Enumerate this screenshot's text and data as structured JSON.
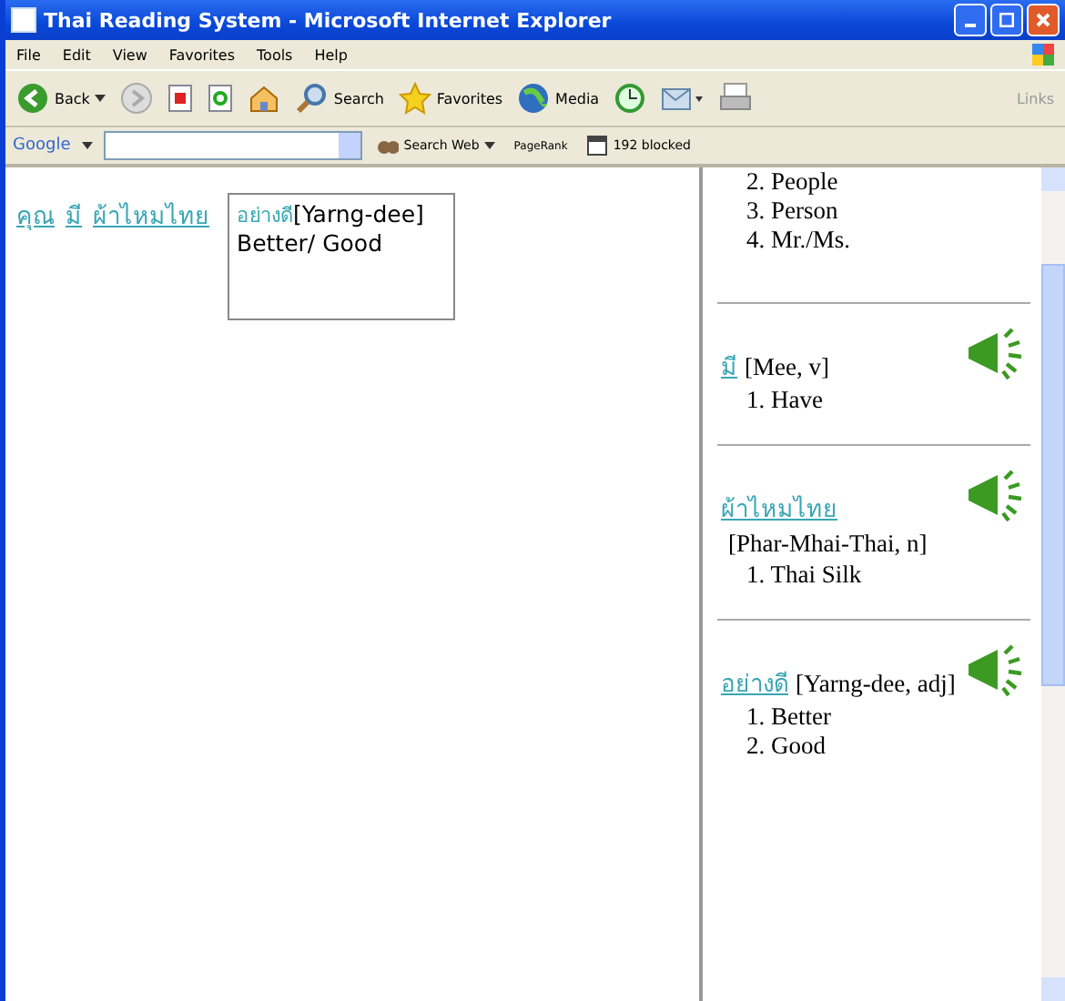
{
  "window": {
    "title": "Thai Reading System - Microsoft Internet Explorer"
  },
  "menu": [
    "File",
    "Edit",
    "View",
    "Favorites",
    "Tools",
    "Help"
  ],
  "toolbar": [
    {
      "kind": "back",
      "label": "Back"
    },
    {
      "kind": "forward"
    },
    {
      "kind": "stop"
    },
    {
      "kind": "refresh"
    },
    {
      "kind": "home"
    },
    {
      "kind": "search",
      "label": "Search"
    },
    {
      "kind": "favorites",
      "label": "Favorites"
    },
    {
      "kind": "media",
      "label": "Media"
    },
    {
      "kind": "history"
    },
    {
      "kind": "mail"
    },
    {
      "kind": "print"
    },
    {
      "kind": "links",
      "label": "Links"
    }
  ],
  "google_bar": {
    "logo": "Google",
    "search_button": "Search Web",
    "pagerank": "PageRank",
    "blocked": "192 blocked"
  },
  "sentence": [
    "คุณ",
    "มี",
    "ผ้าไหมไทย"
  ],
  "popup": {
    "word": "อย่างดี",
    "reading": "[Yarng-dee]",
    "meaning": "Better/ Good"
  },
  "entries": [
    {
      "meanings": [
        "2. People",
        "3. Person",
        "4. Mr./Ms."
      ]
    },
    {
      "word": "มี",
      "reading": "[Mee, v]",
      "meanings": [
        "1. Have"
      ]
    },
    {
      "word": "ผ้าไหมไทย",
      "reading": "[Phar-Mhai-Thai, n]",
      "meanings": [
        "1. Thai Silk"
      ]
    },
    {
      "word": "อย่างดี",
      "reading": "[Yarng-dee, adj]",
      "meanings": [
        "1. Better",
        "2. Good"
      ]
    }
  ]
}
